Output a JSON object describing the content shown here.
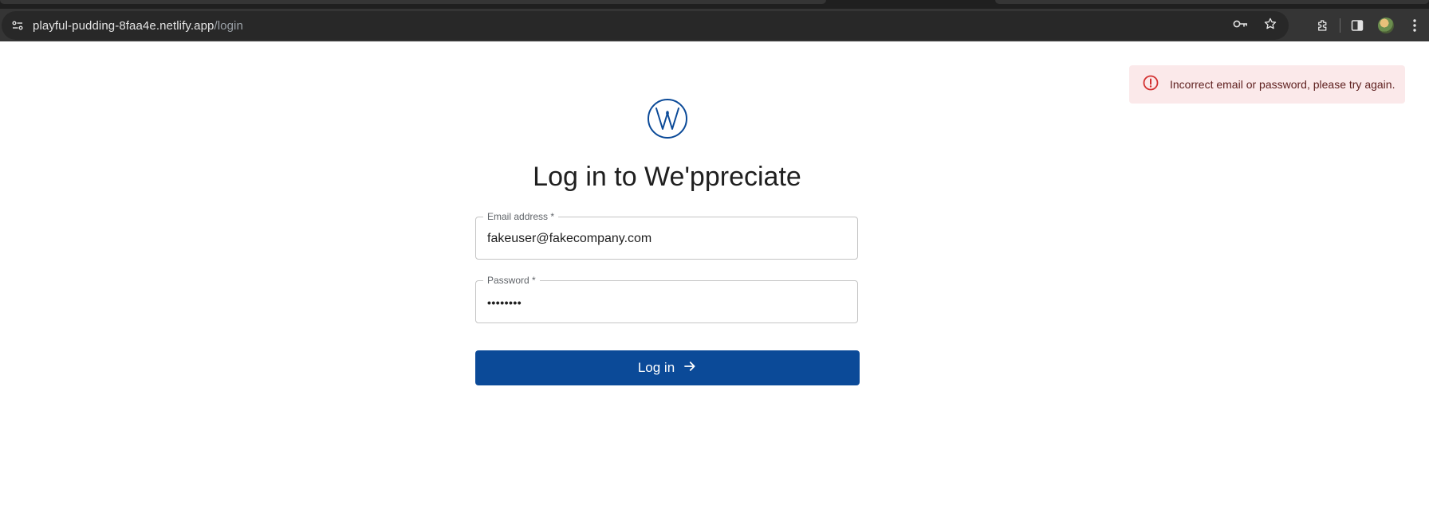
{
  "browser": {
    "url_host": "playful-pudding-8faa4e.netlify.app",
    "url_path": "/login",
    "icons": [
      "site-info-icon",
      "key-icon",
      "star-icon",
      "extensions-icon",
      "side-panel-icon",
      "profile-avatar",
      "menu-icon"
    ]
  },
  "page": {
    "title": "Log in to We'ppreciate",
    "email": {
      "label": "Email address *",
      "value": "fakeuser@fakecompany.com"
    },
    "password": {
      "label": "Password *",
      "value": "••••••••"
    },
    "login_button": {
      "label": "Log in",
      "icon": "arrow-right-icon"
    },
    "alert": {
      "message": "Incorrect email or password, please try again.",
      "icon": "error-icon"
    }
  },
  "colors": {
    "brand": "#0b4a98",
    "alert_bg": "#fbe9ea",
    "alert_icon": "#d32f2f",
    "alert_text": "#5f2120"
  }
}
